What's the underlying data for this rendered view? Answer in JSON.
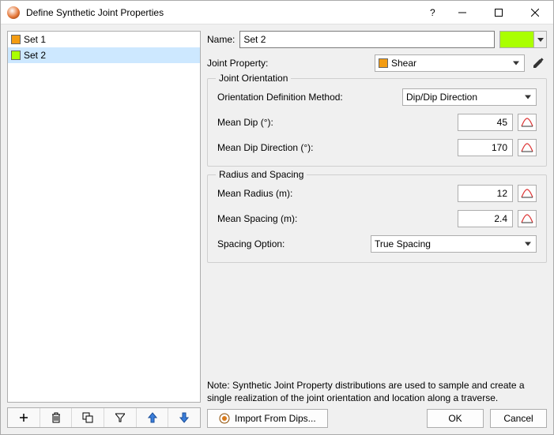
{
  "window": {
    "title": "Define Synthetic Joint Properties"
  },
  "sets": {
    "items": [
      {
        "label": "Set 1",
        "color": "#f39c12",
        "selected": false
      },
      {
        "label": "Set 2",
        "color": "#aaff00",
        "selected": true
      }
    ]
  },
  "name": {
    "label": "Name:",
    "value": "Set 2",
    "color": "#aaff00"
  },
  "jointProperty": {
    "label": "Joint Property:",
    "value": "Shear",
    "swatch": "#f39c12"
  },
  "orientation": {
    "groupTitle": "Joint Orientation",
    "method": {
      "label": "Orientation Definition Method:",
      "value": "Dip/Dip Direction"
    },
    "meanDip": {
      "label": "Mean Dip (°):",
      "value": "45"
    },
    "meanDipDir": {
      "label": "Mean Dip Direction (°):",
      "value": "170"
    }
  },
  "radiusSpacing": {
    "groupTitle": "Radius and Spacing",
    "meanRadius": {
      "label": "Mean Radius (m):",
      "value": "12"
    },
    "meanSpacing": {
      "label": "Mean Spacing (m):",
      "value": "2.4"
    },
    "spacingOption": {
      "label": "Spacing Option:",
      "value": "True Spacing"
    }
  },
  "note": "Note: Synthetic Joint Property distributions are used to sample and create a single realization of the joint orientation and location along a traverse.",
  "buttons": {
    "import": "Import From Dips...",
    "ok": "OK",
    "cancel": "Cancel"
  }
}
